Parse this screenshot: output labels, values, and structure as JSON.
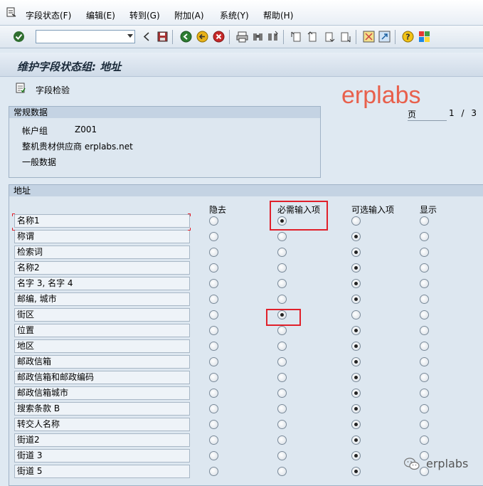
{
  "menubar": {
    "items": [
      "字段状态(F)",
      "编辑(E)",
      "转到(G)",
      "附加(A)",
      "系统(Y)",
      "帮助(H)"
    ]
  },
  "toolbar": {
    "command_value": "",
    "icons": [
      "check-icon",
      "back-icon",
      "save-icon",
      "back-green-icon",
      "exit-icon",
      "cancel-icon",
      "print-icon",
      "find-icon",
      "find-next-icon",
      "first-page-icon",
      "prev-page-icon",
      "next-page-icon",
      "last-page-icon",
      "new-session-icon",
      "shortcut-icon",
      "help-icon",
      "customize-icon"
    ]
  },
  "title": "维护字段状态组: 地址",
  "app_toolbar": {
    "field_check_label": "字段检验"
  },
  "watermark": "erplabs",
  "paging": {
    "page_label": "页",
    "current": "1",
    "slash": "/",
    "total": "3"
  },
  "general": {
    "header": "常规数据",
    "account_group_label": "帐户组",
    "account_group_value": "Z001",
    "description": "整机贵材供应商 erplabs.net",
    "general_data": "一般数据"
  },
  "address": {
    "header": "地址",
    "columns": [
      "隐去",
      "必需输入项",
      "可选输入项",
      "显示"
    ],
    "rows": [
      {
        "label": "名称1",
        "selected": 1
      },
      {
        "label": "称谓",
        "selected": 2
      },
      {
        "label": "检索词",
        "selected": 2
      },
      {
        "label": "名称2",
        "selected": 2
      },
      {
        "label": "名字 3, 名字 4",
        "selected": 2
      },
      {
        "label": "邮编, 城市",
        "selected": 2
      },
      {
        "label": "街区",
        "selected": 1
      },
      {
        "label": "位置",
        "selected": 2
      },
      {
        "label": "地区",
        "selected": 2
      },
      {
        "label": "邮政信箱",
        "selected": 2
      },
      {
        "label": "邮政信箱和邮政编码",
        "selected": 2
      },
      {
        "label": "邮政信箱城市",
        "selected": 2
      },
      {
        "label": "搜索条款 B",
        "selected": 2
      },
      {
        "label": "转交人名称",
        "selected": 2
      },
      {
        "label": "街道2",
        "selected": 2
      },
      {
        "label": "街道 3",
        "selected": 2
      },
      {
        "label": "街道 5",
        "selected": 2
      }
    ]
  },
  "wechat_watermark": "erplabs",
  "colors": {
    "highlight": "#e0202a",
    "watermark": "#e8604c",
    "background": "#dfe9f2"
  }
}
